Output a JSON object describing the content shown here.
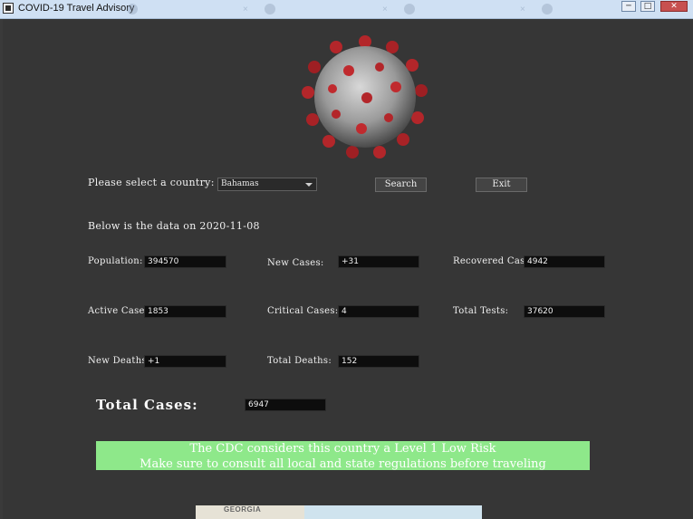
{
  "window": {
    "title": "COVID-19 Travel Advisory",
    "minimize_glyph": "─",
    "maximize_glyph": "□",
    "close_glyph": "✕"
  },
  "form": {
    "country_prompt": "Please select a country:",
    "selected_country": "Bahamas",
    "search_label": "Search",
    "exit_label": "Exit",
    "date_line": "Below is the data on 2020-11-08"
  },
  "stats": {
    "population_label": "Population:",
    "population": "394570",
    "new_cases_label": "New Cases:",
    "new_cases": "+31",
    "recovered_label": "Recovered Cases:",
    "recovered": "4942",
    "active_label": "Active Cases:",
    "active": "1853",
    "critical_label": "Critical Cases:",
    "critical": "4",
    "tests_label": "Total Tests:",
    "tests": "37620",
    "new_deaths_label": "New Deaths:",
    "new_deaths": "+1",
    "total_deaths_label": "Total Deaths:",
    "total_deaths": "152",
    "total_cases_label": "Total Cases:",
    "total_cases": "6947"
  },
  "advisory": {
    "line1": "The CDC considers this country a Level 1 Low Risk",
    "line2": "Make sure to consult all local and state regulations before traveling",
    "color": "#8ee88a"
  },
  "map": {
    "place_label": "GEORGIA"
  }
}
